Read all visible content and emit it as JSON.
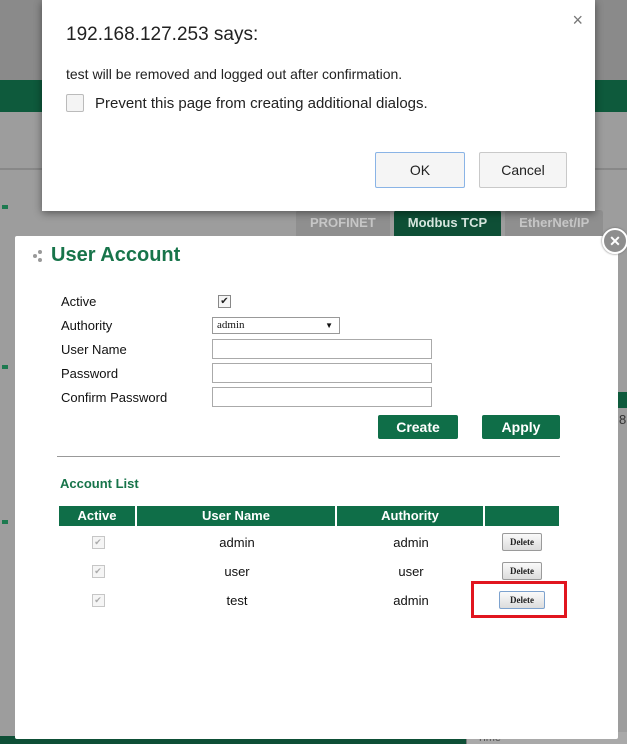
{
  "background": {
    "tabs": [
      "PROFINET",
      "Modbus TCP",
      "EtherNet/IP"
    ],
    "side_char": "8",
    "footer_time": "Time"
  },
  "alert": {
    "title": "192.168.127.253 says:",
    "message": "test will be removed and logged out after confirmation.",
    "checkbox_label": "Prevent this page from creating additional dialogs.",
    "ok_label": "OK",
    "cancel_label": "Cancel",
    "close_icon": "×"
  },
  "modal": {
    "title": "User Account",
    "form": {
      "active_label": "Active",
      "active_checked": true,
      "authority_label": "Authority",
      "authority_value": "admin",
      "username_label": "User Name",
      "username_value": "",
      "password_label": "Password",
      "password_value": "",
      "confirm_label": "Confirm Password",
      "confirm_value": ""
    },
    "create_label": "Create",
    "apply_label": "Apply",
    "account_list_title": "Account List",
    "table": {
      "headers": [
        "Active",
        "User Name",
        "Authority",
        ""
      ],
      "rows": [
        {
          "active": true,
          "user": "admin",
          "authority": "admin",
          "action": "Delete"
        },
        {
          "active": true,
          "user": "user",
          "authority": "user",
          "action": "Delete"
        },
        {
          "active": true,
          "user": "test",
          "authority": "admin",
          "action": "Delete"
        }
      ]
    }
  },
  "colors": {
    "accent_green": "#0f6e48",
    "title_green": "#17744a",
    "highlight_red": "#e1151f"
  }
}
